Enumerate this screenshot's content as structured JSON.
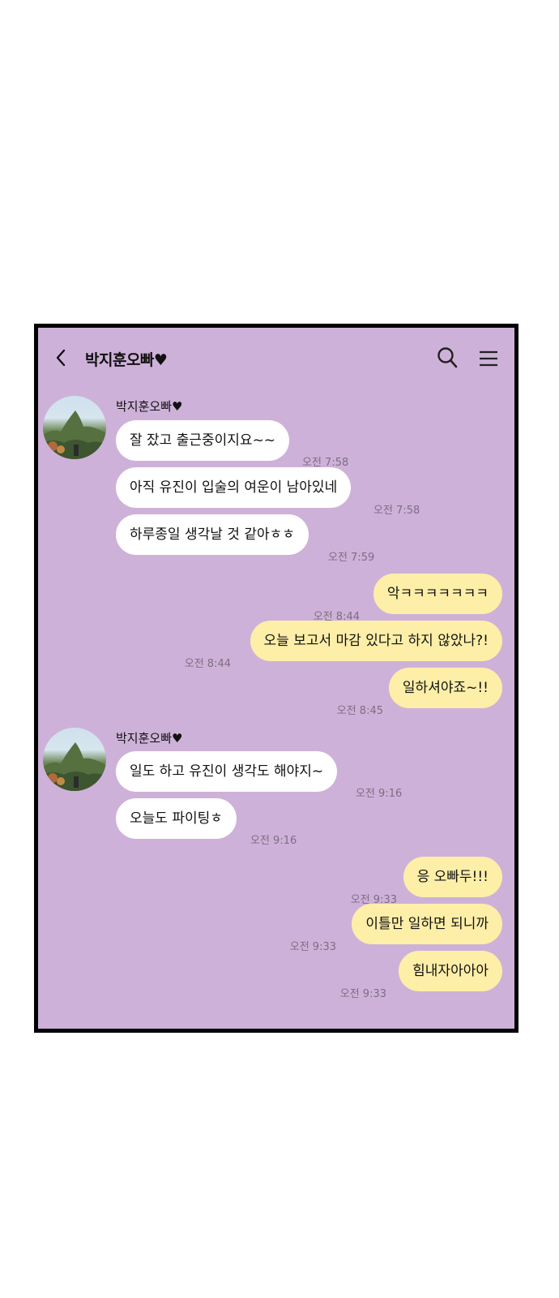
{
  "chat": {
    "title": "박지훈오빠♥",
    "incoming_group_1": {
      "sender": "박지훈오빠♥",
      "messages": [
        {
          "text": "잘 잤고 출근중이지요~~",
          "time": "오전 7:58"
        },
        {
          "text": "아직 유진이 입술의 여운이 남아있네",
          "time": "오전 7:58"
        },
        {
          "text": "하루종일 생각날 것 같아ㅎㅎ",
          "time": "오전 7:59"
        }
      ]
    },
    "outgoing_group_1": {
      "messages": [
        {
          "text": "악ㅋㅋㅋㅋㅋㅋㅋ",
          "time": "오전 8:44"
        },
        {
          "text": "오늘 보고서 마감 있다고 하지 않았나?!",
          "time": "오전 8:44"
        },
        {
          "text": "일하셔야죠~!!",
          "time": "오전 8:45"
        }
      ]
    },
    "incoming_group_2": {
      "sender": "박지훈오빠♥",
      "messages": [
        {
          "text": "일도 하고 유진이 생각도 해야지~",
          "time": "오전 9:16"
        },
        {
          "text": "오늘도 파이팅ㅎ",
          "time": "오전 9:16"
        }
      ]
    },
    "outgoing_group_2": {
      "messages": [
        {
          "text": "응 오빠두!!!",
          "time": "오전 9:33"
        },
        {
          "text": "이틀만 일하면 되니까",
          "time": "오전 9:33"
        },
        {
          "text": "힘내자아아아",
          "time": "오전 9:33"
        }
      ]
    }
  },
  "icons": {
    "back": "chevron-left-icon",
    "search": "search-icon",
    "menu": "hamburger-menu-icon",
    "avatar": "profile-photo-trees"
  },
  "colors": {
    "chat_background": "#ceb1d9",
    "incoming_bubble": "#ffffff",
    "outgoing_bubble": "#fdeea8",
    "frame_border": "#000000"
  }
}
